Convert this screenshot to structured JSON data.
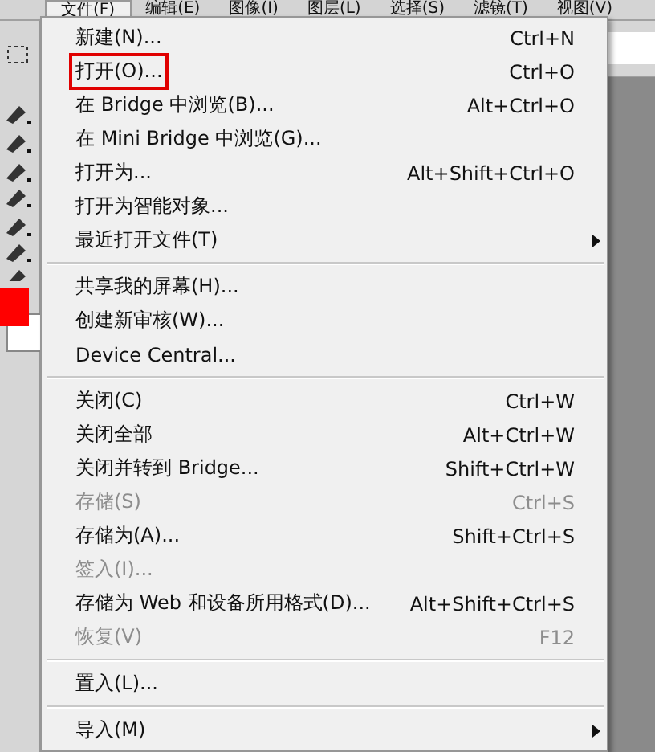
{
  "menubar": [
    {
      "label": "文件(F)",
      "selected": true
    },
    {
      "label": "编辑(E)",
      "selected": false
    },
    {
      "label": "图像(I)",
      "selected": false
    },
    {
      "label": "图层(L)",
      "selected": false
    },
    {
      "label": "选择(S)",
      "selected": false
    },
    {
      "label": "滤镜(T)",
      "selected": false
    },
    {
      "label": "视图(V)",
      "selected": false
    }
  ],
  "menu": [
    {
      "kind": "item",
      "label": "新建(N)...",
      "shortcut": "Ctrl+N",
      "disabled": false,
      "submenu": false,
      "outlined": false
    },
    {
      "kind": "item",
      "label": "打开(O)...",
      "shortcut": "Ctrl+O",
      "disabled": false,
      "submenu": false,
      "outlined": true
    },
    {
      "kind": "item",
      "label": "在 Bridge 中浏览(B)...",
      "shortcut": "Alt+Ctrl+O",
      "disabled": false,
      "submenu": false,
      "outlined": false
    },
    {
      "kind": "item",
      "label": "在 Mini Bridge 中浏览(G)...",
      "disabled": false,
      "submenu": false,
      "outlined": false
    },
    {
      "kind": "item",
      "label": "打开为...",
      "shortcut": "Alt+Shift+Ctrl+O",
      "disabled": false,
      "submenu": false,
      "outlined": false
    },
    {
      "kind": "item",
      "label": "打开为智能对象...",
      "disabled": false,
      "submenu": false,
      "outlined": false
    },
    {
      "kind": "item",
      "label": "最近打开文件(T)",
      "disabled": false,
      "submenu": true,
      "outlined": false
    },
    {
      "kind": "separator"
    },
    {
      "kind": "item",
      "label": "共享我的屏幕(H)...",
      "disabled": false,
      "submenu": false,
      "outlined": false
    },
    {
      "kind": "item",
      "label": "创建新审核(W)...",
      "disabled": false,
      "submenu": false,
      "outlined": false
    },
    {
      "kind": "item",
      "label": "Device Central...",
      "disabled": false,
      "submenu": false,
      "outlined": false
    },
    {
      "kind": "separator"
    },
    {
      "kind": "item",
      "label": "关闭(C)",
      "shortcut": "Ctrl+W",
      "disabled": false,
      "submenu": false,
      "outlined": false
    },
    {
      "kind": "item",
      "label": "关闭全部",
      "shortcut": "Alt+Ctrl+W",
      "disabled": false,
      "submenu": false,
      "outlined": false
    },
    {
      "kind": "item",
      "label": "关闭并转到 Bridge...",
      "shortcut": "Shift+Ctrl+W",
      "disabled": false,
      "submenu": false,
      "outlined": false
    },
    {
      "kind": "item",
      "label": "存储(S)",
      "shortcut": "Ctrl+S",
      "disabled": true,
      "submenu": false,
      "outlined": false
    },
    {
      "kind": "item",
      "label": "存储为(A)...",
      "shortcut": "Shift+Ctrl+S",
      "disabled": false,
      "submenu": false,
      "outlined": false
    },
    {
      "kind": "item",
      "label": "签入(I)...",
      "disabled": true,
      "submenu": false,
      "outlined": false
    },
    {
      "kind": "item",
      "label": "存储为 Web 和设备所用格式(D)...",
      "shortcut": "Alt+Shift+Ctrl+S",
      "disabled": false,
      "submenu": false,
      "outlined": false
    },
    {
      "kind": "item",
      "label": "恢复(V)",
      "shortcut": "F12",
      "disabled": true,
      "submenu": false,
      "outlined": false
    },
    {
      "kind": "separator"
    },
    {
      "kind": "item",
      "label": "置入(L)...",
      "disabled": false,
      "submenu": false,
      "outlined": false
    },
    {
      "kind": "separator"
    },
    {
      "kind": "item",
      "label": "导入(M)",
      "disabled": false,
      "submenu": true,
      "outlined": false
    }
  ]
}
